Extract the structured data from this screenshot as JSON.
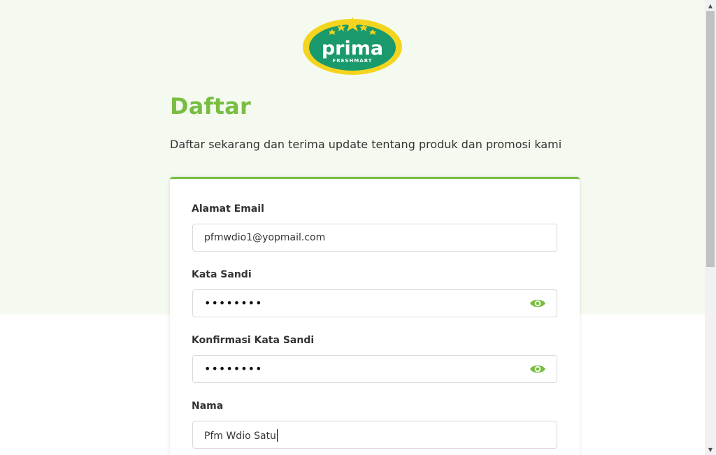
{
  "brand": {
    "logo_text": "prima",
    "logo_subtext": "FRESHMART",
    "colors": {
      "green": "#1a9a6c",
      "yellow": "#f4d41f",
      "accent": "#79be43"
    }
  },
  "header": {
    "title": "Daftar",
    "subtitle": "Daftar sekarang dan terima update tentang produk dan promosi kami"
  },
  "form": {
    "email": {
      "label": "Alamat Email",
      "value": "pfmwdio1@yopmail.com"
    },
    "password": {
      "label": "Kata Sandi",
      "masked_value": "••••••••",
      "toggle_icon": "eye-icon"
    },
    "confirm_password": {
      "label": "Konfirmasi Kata Sandi",
      "masked_value": "••••••••",
      "toggle_icon": "eye-icon"
    },
    "name": {
      "label": "Nama",
      "value": "Pfm Wdio Satu"
    }
  }
}
